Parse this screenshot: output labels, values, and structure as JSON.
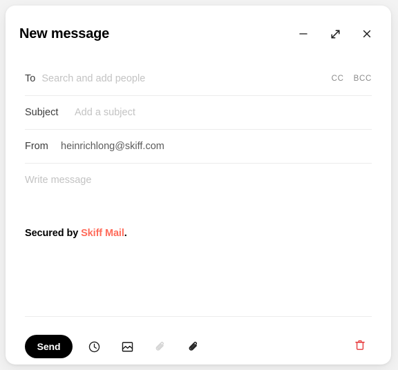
{
  "window": {
    "title": "New message",
    "controls": [
      {
        "name": "minimize",
        "icon": "minimize-icon"
      },
      {
        "name": "expand",
        "icon": "expand-diagonal-icon"
      },
      {
        "name": "close",
        "icon": "close-icon"
      }
    ]
  },
  "fields": {
    "to": {
      "label": "To",
      "placeholder": "Search and add people",
      "value": ""
    },
    "cc": {
      "label": "CC"
    },
    "bcc": {
      "label": "BCC"
    },
    "subject": {
      "label": "Subject",
      "placeholder": "Add a subject",
      "value": ""
    },
    "from": {
      "label": "From",
      "value": "heinrichlong@skiff.com"
    }
  },
  "body": {
    "placeholder": "Write message",
    "signature_prefix": "Secured by ",
    "signature_link": "Skiff Mail",
    "signature_suffix": "."
  },
  "footer": {
    "send_label": "Send",
    "tools": [
      {
        "name": "schedule-send",
        "icon": "clock-icon",
        "disabled": false
      },
      {
        "name": "insert-image",
        "icon": "image-icon",
        "disabled": false
      },
      {
        "name": "attach-link",
        "icon": "paperclip-outline-icon",
        "disabled": true
      },
      {
        "name": "attach-file",
        "icon": "paperclip-icon",
        "disabled": false
      }
    ],
    "delete": {
      "name": "delete-draft",
      "icon": "trash-icon"
    }
  },
  "colors": {
    "accent": "#ff6b5a",
    "danger": "#e8484a",
    "send_bg": "#000000",
    "page_bg": "#f3f3f3",
    "card_bg": "#ffffff",
    "divider": "#ececec",
    "placeholder": "#c3c3c3"
  }
}
